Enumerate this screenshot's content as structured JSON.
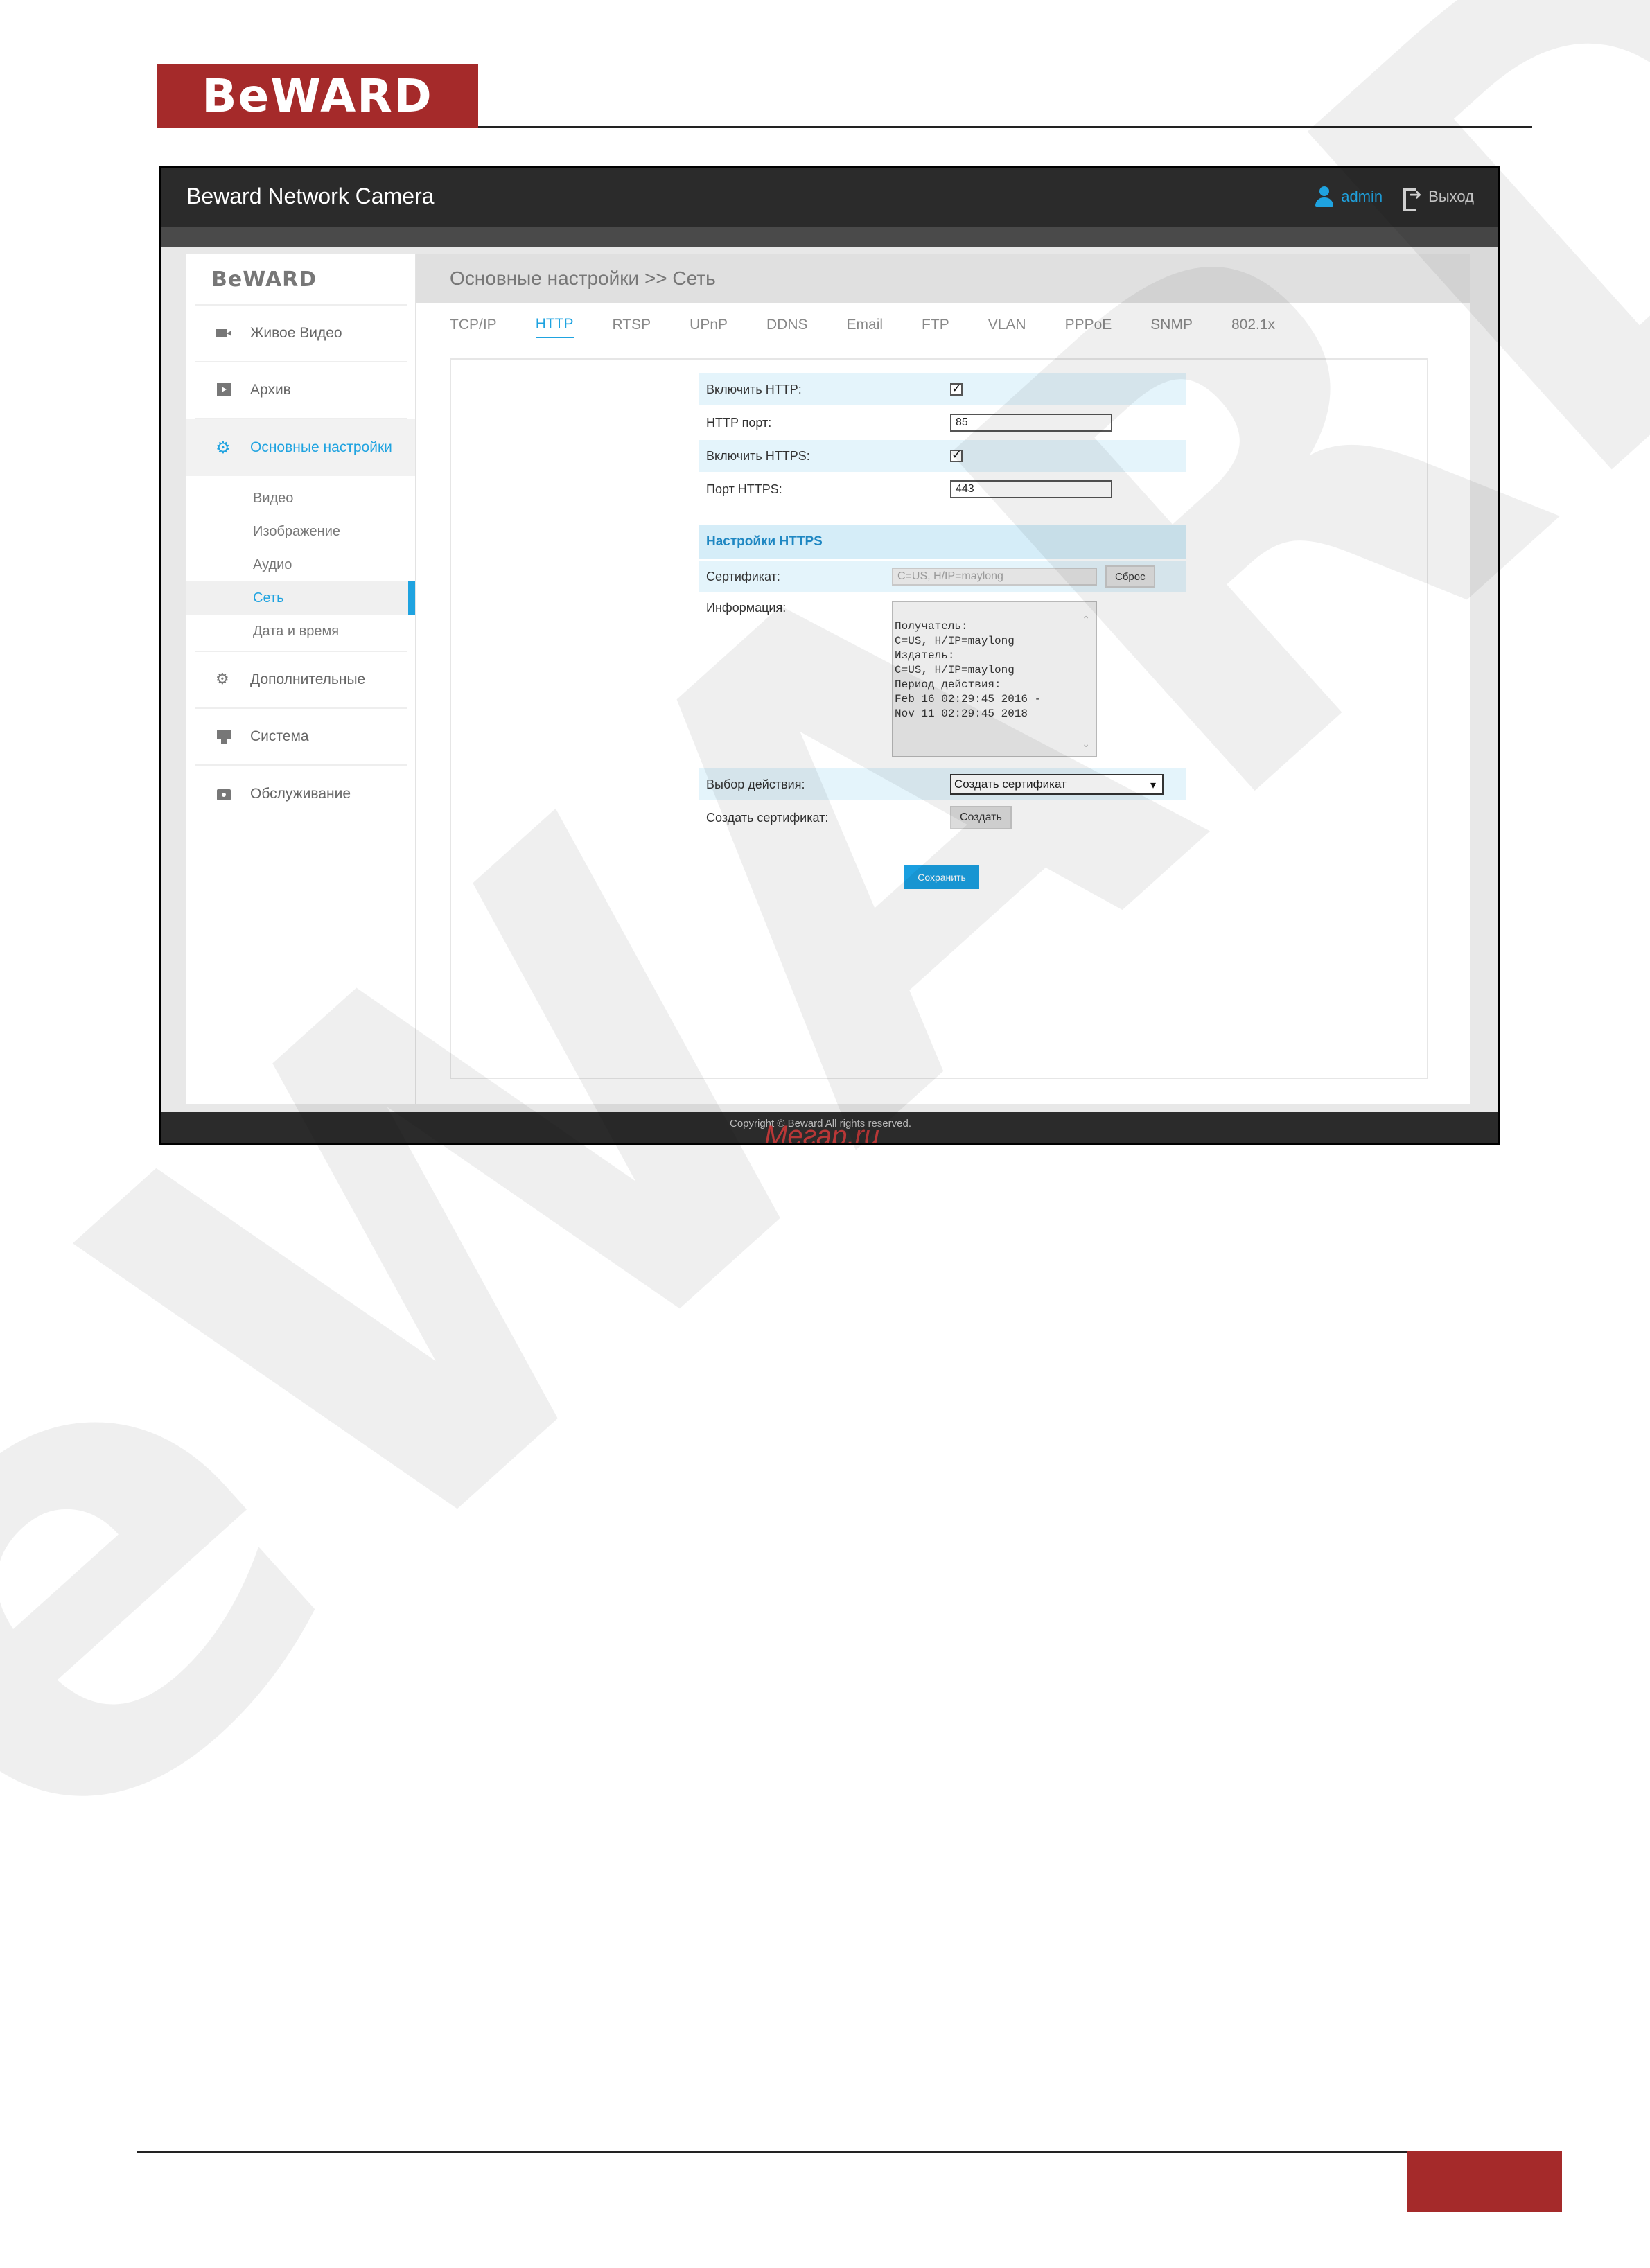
{
  "doc": {
    "logo_text": "BeWARD"
  },
  "app": {
    "title": "Beward Network Camera",
    "user": "admin",
    "logout": "Выход",
    "sidebar_logo": "BeWARD",
    "accent_color": "#1fa3e0"
  },
  "sidebar": {
    "items": [
      {
        "label": "Живое Видео",
        "icon": "video-camera-icon"
      },
      {
        "label": "Архив",
        "icon": "play-icon"
      },
      {
        "label": "Основные настройки",
        "icon": "gear-icon"
      },
      {
        "label": "Дополнительные",
        "icon": "gears-icon"
      },
      {
        "label": "Система",
        "icon": "monitor-icon"
      },
      {
        "label": "Обслуживание",
        "icon": "camera-icon"
      }
    ],
    "sub_items": [
      "Видео",
      "Изображение",
      "Аудио",
      "Сеть",
      "Дата и время"
    ]
  },
  "main": {
    "breadcrumb": "Основные настройки >> Сеть",
    "tabs": [
      "TCP/IP",
      "HTTP",
      "RTSP",
      "UPnP",
      "DDNS",
      "Email",
      "FTP",
      "VLAN",
      "PPPoE",
      "SNMP",
      "802.1x"
    ],
    "active_tab": "HTTP"
  },
  "form": {
    "enable_http_label": "Включить HTTP:",
    "enable_http": true,
    "http_port_label": "HTTP порт:",
    "http_port": "85",
    "enable_https_label": "Включить HTTPS:",
    "enable_https": true,
    "https_port_label": "Порт HTTPS:",
    "https_port": "443",
    "https_section": "Настройки HTTPS",
    "certificate_label": "Сертификат:",
    "certificate_value": "C=US, H/IP=maylong",
    "reset_button": "Сброс",
    "info_label": "Информация:",
    "info_text": "Получатель:\nC=US, H/IP=maylong\nИздатель:\nC=US, H/IP=maylong\nПериод действия:\nFeb 16 02:29:45 2016  -\nNov 11 02:29:45 2018",
    "action_label": "Выбор действия:",
    "action_value": "Создать сертификат",
    "create_cert_label": "Создать сертификат:",
    "create_button": "Создать",
    "save_button": "Сохранить"
  },
  "footer": {
    "copyright": "Copyright © Beward All rights reserved.",
    "stamp": "Мегар.ru"
  }
}
